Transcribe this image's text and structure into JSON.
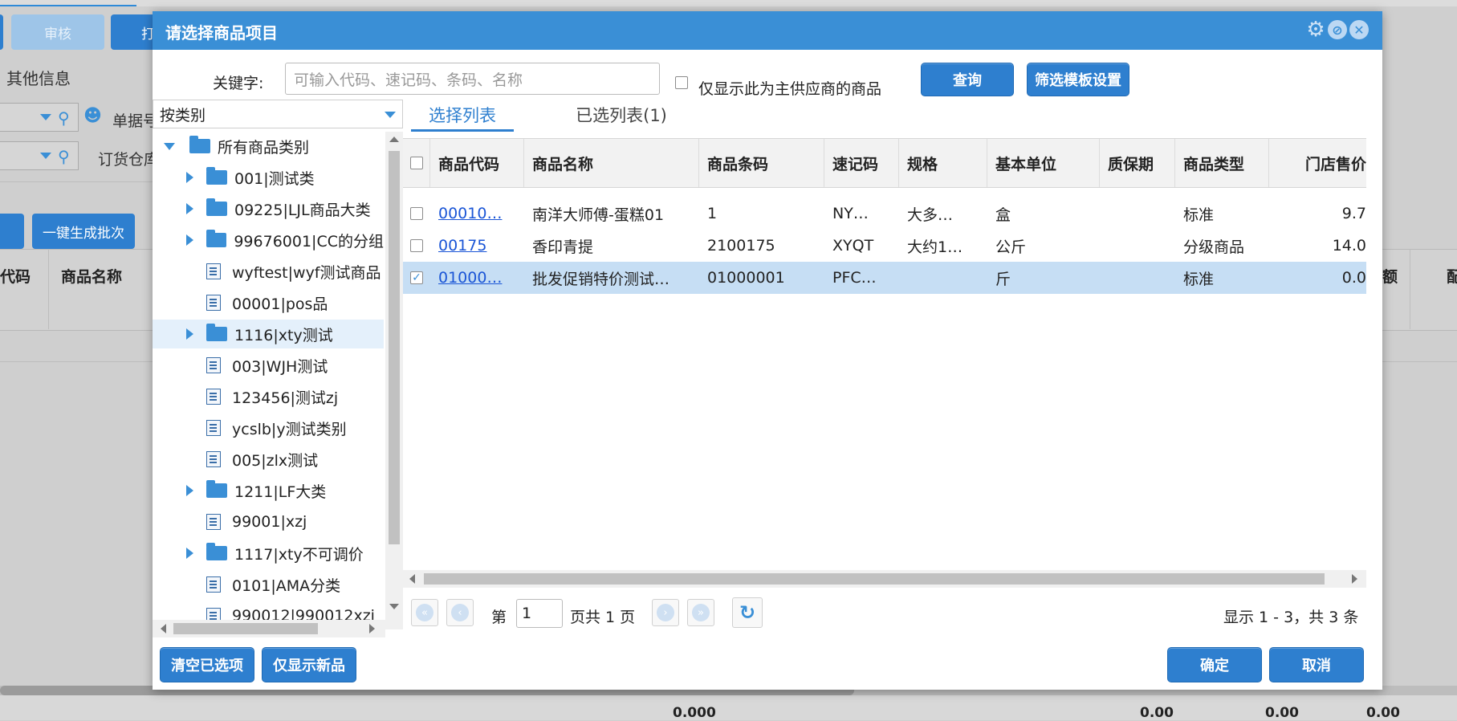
{
  "background": {
    "buttons": {
      "audit": "审核",
      "print_partial": "打",
      "generate_batch": "一键生成批次"
    },
    "tabs": {
      "other_info": "其他信息"
    },
    "fields": {
      "doc_number": "单据号",
      "order_warehouse": "订货仓库"
    },
    "table": {
      "col_code": "代码",
      "col_name": "商品名称",
      "col_right": "配"
    },
    "totals": [
      "0.000",
      "0.00",
      "0.00",
      "0.00"
    ]
  },
  "dialog": {
    "title": "请选择商品项目",
    "search": {
      "label": "关键字:",
      "placeholder": "可输入代码、速记码、条码、名称",
      "main_supplier_only": "仅显示此为主供应商的商品",
      "query_button": "查询",
      "filter_template_button": "筛选模板设置"
    },
    "category_select": "按类别",
    "tree": [
      {
        "label": "所有商品类别",
        "type": "folder",
        "expanded": true,
        "level": 0
      },
      {
        "label": "001|测试类",
        "type": "folder",
        "level": 1
      },
      {
        "label": "09225|LJL商品大类",
        "type": "folder",
        "level": 1
      },
      {
        "label": "99676001|CC的分组",
        "type": "folder",
        "level": 1
      },
      {
        "label": "wyftest|wyf测试商品",
        "type": "doc",
        "level": 1
      },
      {
        "label": "00001|pos品",
        "type": "doc",
        "level": 1
      },
      {
        "label": "1116|xty测试",
        "type": "folder",
        "level": 1,
        "selected": true
      },
      {
        "label": "003|WJH测试",
        "type": "doc",
        "level": 1
      },
      {
        "label": "123456|测试zj",
        "type": "doc",
        "level": 1
      },
      {
        "label": "ycslb|y测试类别",
        "type": "doc",
        "level": 1
      },
      {
        "label": "005|zlx测试",
        "type": "doc",
        "level": 1
      },
      {
        "label": "1211|LF大类",
        "type": "folder",
        "level": 1
      },
      {
        "label": "99001|xzj",
        "type": "doc",
        "level": 1
      },
      {
        "label": "1117|xty不可调价",
        "type": "folder",
        "level": 1
      },
      {
        "label": "0101|AMA分类",
        "type": "doc",
        "level": 1
      },
      {
        "label": "990012|990012xzj",
        "type": "doc",
        "level": 1
      }
    ],
    "tabs": {
      "select_list": "选择列表",
      "selected_list": "已选列表(1)"
    },
    "columns": [
      "商品代码",
      "商品名称",
      "商品条码",
      "速记码",
      "规格",
      "基本单位",
      "质保期",
      "商品类型",
      "门店售价"
    ],
    "rows": [
      {
        "checked": false,
        "code": "00010…",
        "name": "南洋大师傅-蛋糕01",
        "barcode": "1",
        "shorthand": "NY…",
        "spec": "大多…",
        "unit": "盒",
        "shelf_life": "",
        "type": "标准",
        "price": "9.7"
      },
      {
        "checked": false,
        "code": "00175",
        "name": "香印青提",
        "barcode": "2100175",
        "shorthand": "XYQT",
        "spec": "大约1…",
        "unit": "公斤",
        "shelf_life": "",
        "type": "分级商品",
        "price": "14.0"
      },
      {
        "checked": true,
        "code": "01000…",
        "name": "批发促销特价测试…",
        "barcode": "01000001",
        "shorthand": "PFC…",
        "spec": "",
        "unit": "斤",
        "shelf_life": "",
        "type": "标准",
        "price": "0.0"
      }
    ],
    "pager": {
      "page_prefix": "第",
      "page_value": "1",
      "page_suffix": "页共 1 页",
      "summary": "显示 1 - 3，共 3 条"
    },
    "footer": {
      "clear_selected": "清空已选项",
      "show_new_only": "仅显示新品",
      "ok": "确定",
      "cancel": "取消"
    }
  },
  "colors": {
    "accent": "#3a8fd6",
    "button": "#2e7fcf",
    "link": "#1a55d6",
    "row_selected": "#c6def4"
  }
}
